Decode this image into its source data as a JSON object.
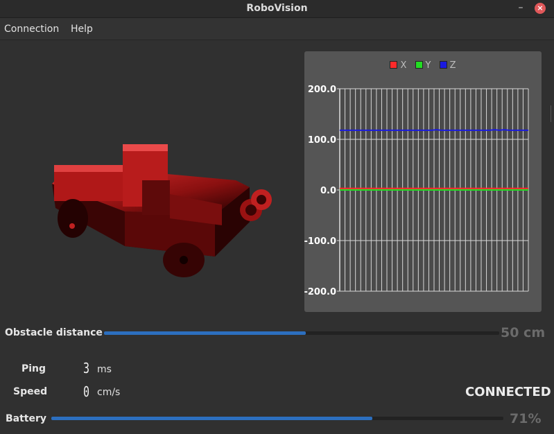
{
  "window": {
    "title": "RoboVision"
  },
  "menu": {
    "items": [
      "Connection",
      "Help"
    ]
  },
  "chart_data": {
    "type": "line",
    "legend": [
      "X",
      "Y",
      "Z"
    ],
    "ylim": [
      -200,
      200
    ],
    "y_ticks": [
      "200.0",
      "100.0",
      "0.0",
      "-100.0",
      "-200.0"
    ],
    "grid": true,
    "legend_position": "top-center",
    "series": [
      {
        "name": "X",
        "color": "#ff2a2a",
        "values": [
          3,
          3,
          3,
          3,
          3,
          3,
          3,
          3,
          3,
          3,
          3,
          3,
          3,
          3,
          3,
          3,
          3,
          3,
          3,
          3,
          3,
          3,
          3,
          3,
          3,
          3,
          3,
          3,
          3,
          3,
          3,
          3,
          3,
          3,
          3,
          3,
          3,
          3,
          3,
          3
        ]
      },
      {
        "name": "Y",
        "color": "#22dd22",
        "values": [
          0,
          0,
          0,
          0,
          0,
          0,
          0,
          0,
          0,
          0,
          0,
          0,
          0,
          0,
          0,
          0,
          0,
          0,
          0,
          0,
          0,
          0,
          0,
          0,
          0,
          0,
          0,
          0,
          0,
          0,
          0,
          0,
          0,
          0,
          0,
          0,
          0,
          0,
          0,
          0
        ]
      },
      {
        "name": "Z",
        "color": "#1a1adf",
        "values": [
          118,
          118,
          118,
          118,
          118,
          118,
          118,
          118,
          118,
          118,
          118,
          118,
          118,
          118,
          118,
          118,
          118,
          118,
          118,
          118,
          119,
          118,
          118,
          118,
          118,
          118,
          118,
          118,
          118,
          118,
          118,
          118,
          119,
          118,
          119,
          118,
          118,
          118,
          118,
          118
        ]
      }
    ]
  },
  "obstacle": {
    "label": "Obstacle distance",
    "fraction": 0.51,
    "value": "50 cm"
  },
  "ping": {
    "label": "Ping",
    "value": "3",
    "unit": "ms"
  },
  "speed": {
    "label": "Speed",
    "value": "0",
    "unit": "cm/s"
  },
  "status": {
    "text": "CONNECTED"
  },
  "battery": {
    "label": "Battery",
    "percent": 71,
    "value": "71%"
  },
  "colors": {
    "accent": "#2c6fbf",
    "robot": "#cc1a1a"
  },
  "icons": {
    "minimize": "minimize-icon",
    "close": "close-icon"
  }
}
